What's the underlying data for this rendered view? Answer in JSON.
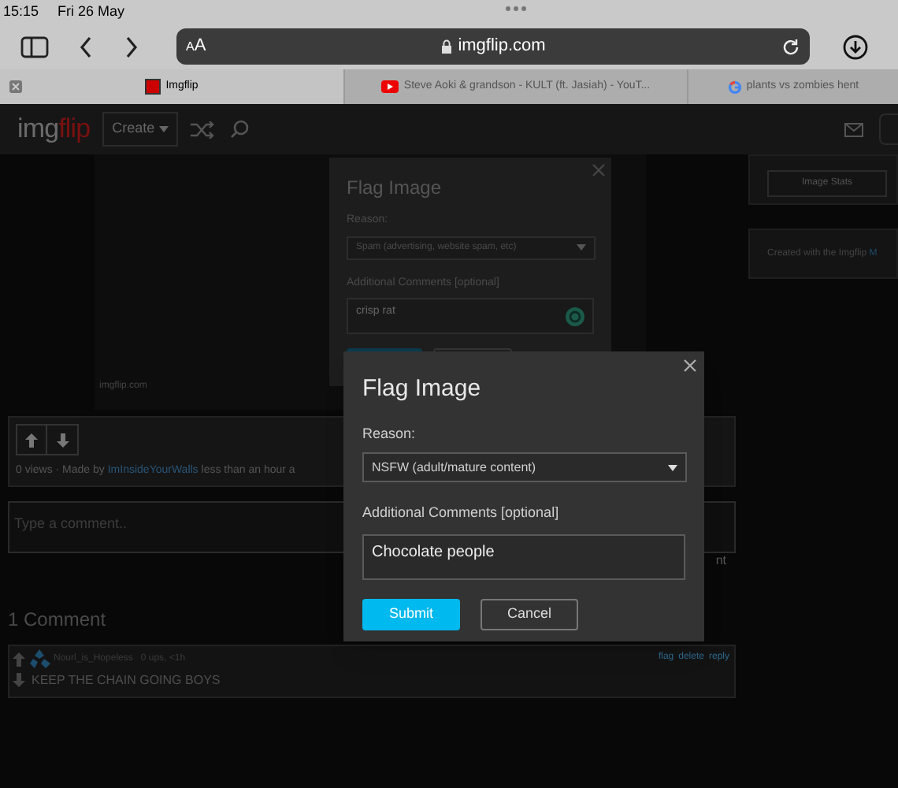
{
  "status_bar": {
    "time": "15:15",
    "date": "Fri 26 May"
  },
  "toolbar": {
    "text_size": "AA",
    "url": "imgflip.com"
  },
  "tabs": [
    {
      "title": "Imgflip",
      "kind": "site",
      "selected": true
    },
    {
      "title": "Steve Aoki & grandson - KULT (ft. Jasiah) - YouT...",
      "kind": "video",
      "selected": false
    },
    {
      "title": "plants vs zombies hent",
      "kind": "search",
      "selected": false
    }
  ],
  "site_header": {
    "logo_gray": "img",
    "logo_red": "flip",
    "create_menu": "Create"
  },
  "post": {
    "image_caption": "imgflip.com",
    "views": "0 views · Made by ",
    "author": "ImInsideYourWalls",
    "time": " less than an hour a"
  },
  "comment_box": {
    "placeholder": "Type a comment..",
    "button_fragment": "nt"
  },
  "comments": {
    "heading": "1 Comment",
    "items": [
      {
        "user": "Nourl_is_Hopeless",
        "meta": "0 ups, <1h",
        "text": "KEEP THE CHAIN GOING BOYS",
        "actions": [
          "flag",
          "delete",
          "reply"
        ]
      }
    ]
  },
  "sidebar": {
    "stats_button": "Image Stats",
    "created_with": "Created with the Imgflip ",
    "created_link": "M"
  },
  "flag_dialogs": [
    {
      "dimmed": true,
      "title": "Flag Image",
      "reason_label": "Reason:",
      "reason": "Spam (advertising, website spam, etc)",
      "comments_label": "Additional Comments [optional]",
      "comment": "crisp rat"
    },
    {
      "dimmed": false,
      "title": "Flag Image",
      "reason_label": "Reason:",
      "reason": "NSFW (adult/mature content)",
      "comments_label": "Additional Comments [optional]",
      "comment": "Chocolate people",
      "submit": "Submit",
      "cancel": "Cancel"
    }
  ]
}
